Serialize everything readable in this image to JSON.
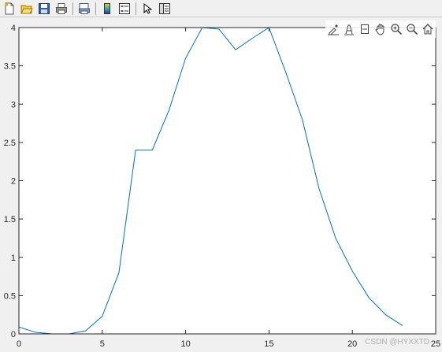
{
  "toolbar": {
    "icons": [
      "new-figure-icon",
      "open-file-icon",
      "save-icon",
      "print-icon",
      "print-preview-icon",
      "insert-colorbar-icon",
      "insert-legend-icon",
      "edit-plot-icon",
      "property-inspector-icon"
    ]
  },
  "axes_toolbar": {
    "icons": [
      "brush-icon",
      "data-tips-icon",
      "restore-icon",
      "pan-icon",
      "zoom-in-icon",
      "zoom-out-icon",
      "home-icon"
    ]
  },
  "watermark": "CSDN @HYXXTD",
  "colors": {
    "line": "#0072bd",
    "axes": "#262626",
    "background": "#ffffff",
    "figure": "#f0f0f0"
  },
  "chart_data": {
    "type": "line",
    "title": "",
    "xlabel": "",
    "ylabel": "",
    "xlim": [
      0,
      25
    ],
    "ylim": [
      0,
      4
    ],
    "xticks": [
      0,
      5,
      10,
      15,
      20,
      25
    ],
    "yticks": [
      0,
      0.5,
      1,
      1.5,
      2,
      2.5,
      3,
      3.5,
      4
    ],
    "ytick_labels": [
      "0",
      "0.5",
      "1",
      "1.5",
      "2",
      "2.5",
      "3",
      "3.5",
      "4"
    ],
    "grid": false,
    "series": [
      {
        "x": [
          0,
          1,
          2,
          3,
          4,
          5,
          6,
          7,
          8,
          9,
          10,
          11,
          12,
          13,
          14,
          15,
          16,
          17,
          18,
          19,
          20,
          21,
          22,
          23
        ],
        "values": [
          0.09,
          0.02,
          0.0,
          0.0,
          0.04,
          0.23,
          0.8,
          2.4,
          2.4,
          2.92,
          3.6,
          4.0,
          3.98,
          3.71,
          3.86,
          4.0,
          3.42,
          2.8,
          1.9,
          1.25,
          0.82,
          0.47,
          0.25,
          0.11
        ]
      }
    ]
  }
}
